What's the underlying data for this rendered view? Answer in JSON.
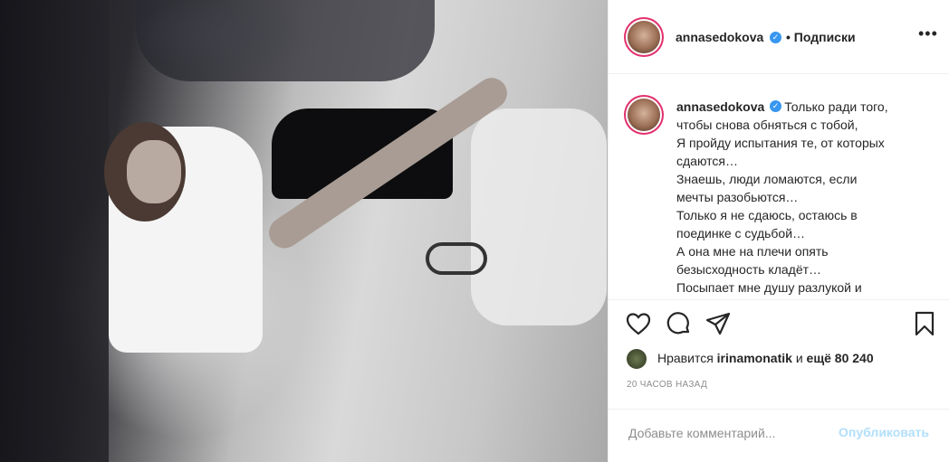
{
  "post": {
    "username": "annasedokova",
    "follow_status": "• Подписки",
    "more_icon": "more-icon",
    "caption_user": "annasedokova",
    "caption_text": "Только ради того,\nчтобы снова обняться с тобой,\nЯ пройду испытания те, от которых\nсдаются…\nЗнаешь, люди ломаются, если\nмечты разобьются…\nТолько я не сдаюсь, остаюсь в\nпоединке с судьбой…\nА она мне на плечи опять\nбезысходность кладёт…\nПосыпает мне душу разлукой и",
    "likes_prefix": "Нравится",
    "likes_user": "irinamonatik",
    "likes_and": "и",
    "likes_count": "ещё 80 240",
    "timestamp": "20 ЧАСОВ НАЗАД",
    "comment_placeholder": "Добавьте комментарий...",
    "publish_label": "Опубликовать"
  },
  "colors": {
    "accent": "#3897f0",
    "publish_disabled": "#b2dffc",
    "text": "#262626",
    "muted": "#8e8e8e"
  }
}
